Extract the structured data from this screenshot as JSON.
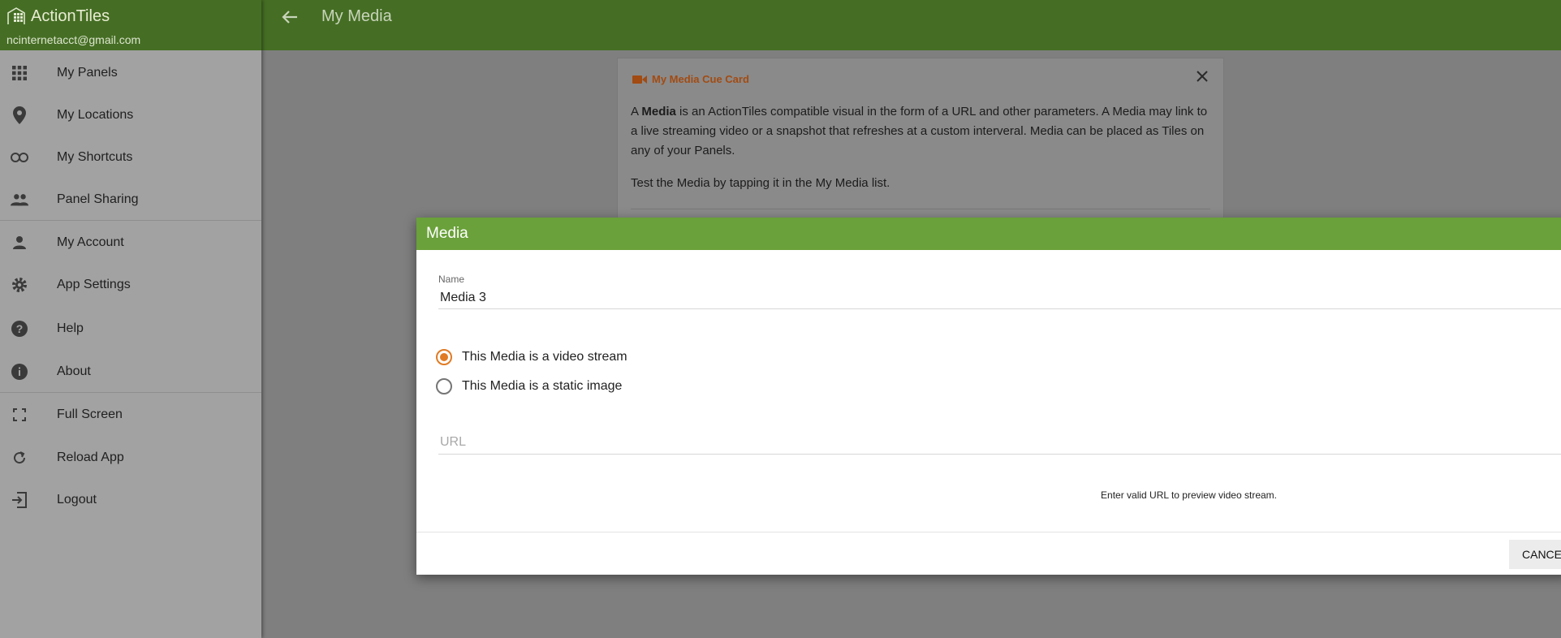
{
  "app": {
    "brand": "ActionTiles",
    "account_email": "ncinternetacct@gmail.com"
  },
  "sidebar": {
    "items": [
      {
        "label": "My Panels",
        "icon": "grid-icon"
      },
      {
        "label": "My Locations",
        "icon": "location-pin-icon"
      },
      {
        "label": "My Shortcuts",
        "icon": "link-icon"
      },
      {
        "label": "Panel Sharing",
        "icon": "people-icon"
      },
      {
        "label": "My Account",
        "icon": "person-icon"
      },
      {
        "label": "App Settings",
        "icon": "gear-icon"
      },
      {
        "label": "Help",
        "icon": "help-icon"
      },
      {
        "label": "About",
        "icon": "info-icon"
      },
      {
        "label": "Full Screen",
        "icon": "fullscreen-icon"
      },
      {
        "label": "Reload App",
        "icon": "reload-icon"
      },
      {
        "label": "Logout",
        "icon": "logout-icon"
      }
    ]
  },
  "topbar": {
    "title": "My Media"
  },
  "cue_card": {
    "title": "My Media Cue Card",
    "para1_prefix": "A ",
    "para1_bold": "Media",
    "para1_rest": " is an ActionTiles compatible visual in the form of a URL and other parameters. A Media may link to a live streaming video or a snapshot that refreshes at a custom interveral. Media can be placed as Tiles on any of your Panels.",
    "para2": "Test the Media by tapping it in the My Media list."
  },
  "dialog": {
    "title": "Media",
    "name_label": "Name",
    "name_value": "Media 3",
    "radio_video": "This Media is a video stream",
    "radio_static": "This Media is a static image",
    "selected": "video",
    "url_placeholder": "URL",
    "preview_hint": "Enter valid URL to preview video stream.",
    "cancel_label": "CANCEL"
  },
  "colors": {
    "header_green": "#456e24",
    "dialog_header_green": "#6aa13a",
    "accent_orange": "#e07b24"
  }
}
